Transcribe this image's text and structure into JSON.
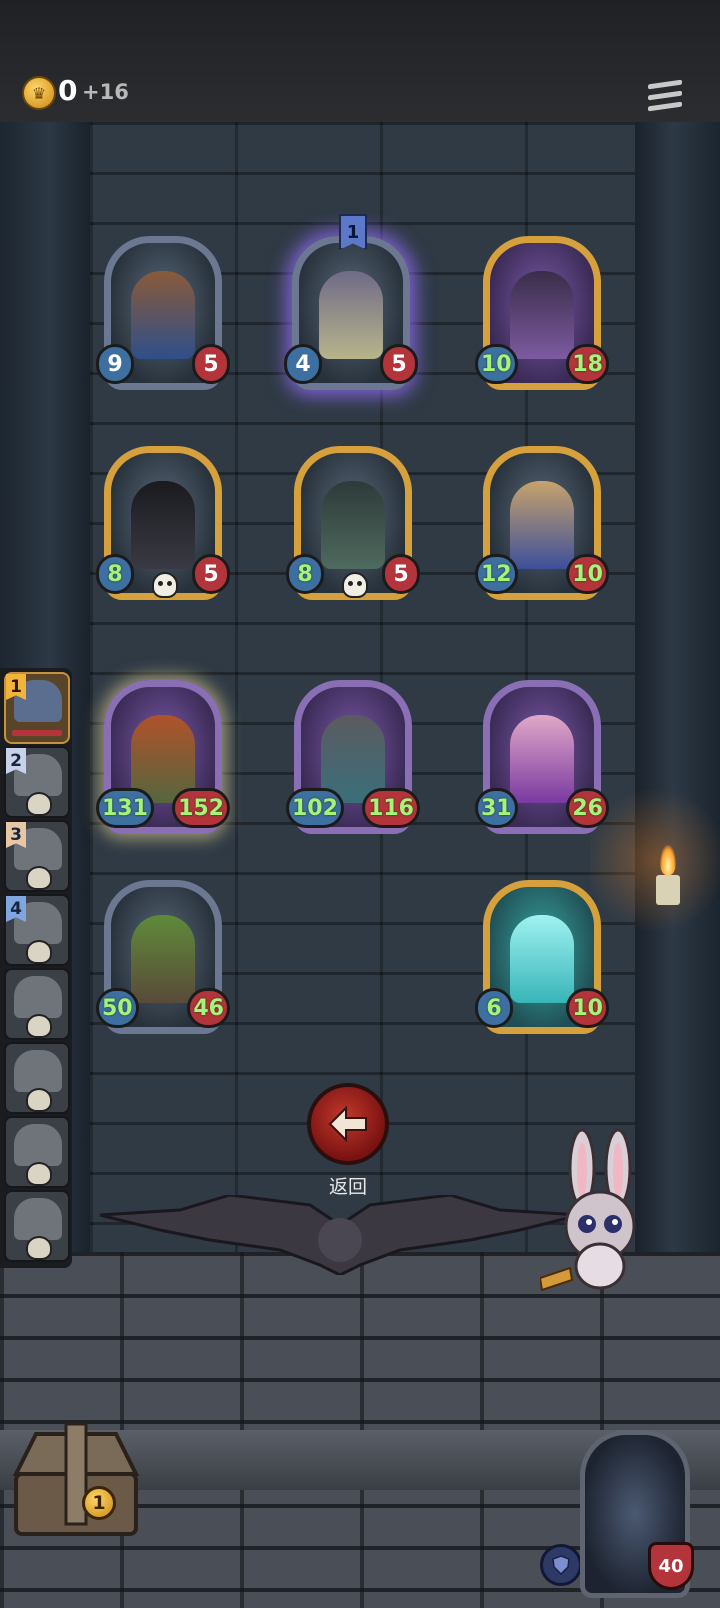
{
  "header": {
    "gold": "0",
    "gold_gain": "+16"
  },
  "board": {
    "cards": [
      {
        "name": "adventurer",
        "attack": "9",
        "health": "5",
        "tier": ""
      },
      {
        "name": "hooded-bear",
        "attack": "4",
        "health": "5",
        "tier": "1"
      },
      {
        "name": "octopus-pirate",
        "attack": "10",
        "health": "18",
        "tier": ""
      },
      {
        "name": "shadow-reaper",
        "attack": "8",
        "health": "5",
        "tier": ""
      },
      {
        "name": "toothy-monster",
        "attack": "8",
        "health": "5",
        "tier": ""
      },
      {
        "name": "masked-dancer",
        "attack": "12",
        "health": "10",
        "tier": ""
      },
      {
        "name": "red-haired-brute",
        "attack": "131",
        "health": "152",
        "tier": ""
      },
      {
        "name": "mole-rogue",
        "attack": "102",
        "health": "116",
        "tier": ""
      },
      {
        "name": "bow-princess",
        "attack": "31",
        "health": "26",
        "tier": ""
      },
      {
        "name": "tree-owl",
        "attack": "50",
        "health": "46",
        "tier": ""
      },
      {
        "name": "ghost-girl",
        "attack": "6",
        "health": "10",
        "tier": ""
      }
    ]
  },
  "lineup": {
    "slots": [
      {
        "number": "1"
      },
      {
        "number": "2"
      },
      {
        "number": "3"
      },
      {
        "number": "4"
      },
      {
        "number": ""
      },
      {
        "number": ""
      },
      {
        "number": ""
      },
      {
        "number": ""
      }
    ]
  },
  "controls": {
    "return_label": "返回"
  },
  "bottom": {
    "chest_count": "1",
    "hero_health": "40"
  },
  "colors": {
    "gold_frame": "#d6a13c",
    "attack_blue": "#3d6fa0",
    "health_red": "#b3343a",
    "stat_green": "#a6f27a"
  }
}
